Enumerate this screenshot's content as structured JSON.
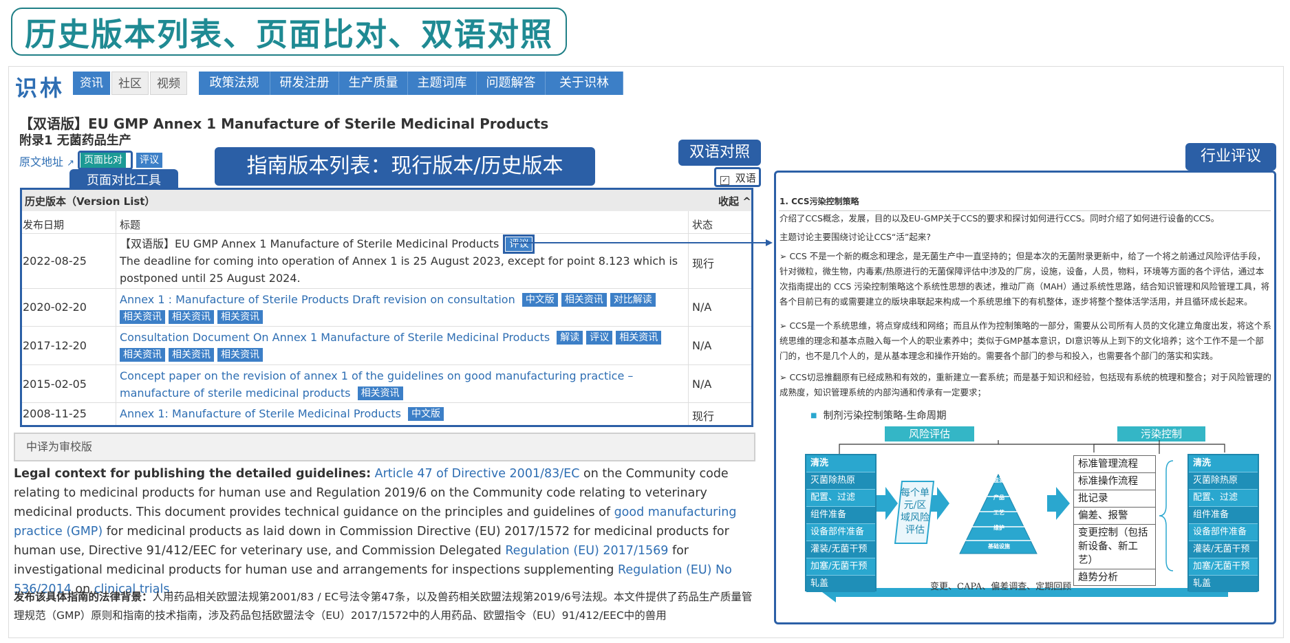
{
  "banner": {
    "title": "历史版本列表、页面比对、双语对照"
  },
  "header": {
    "logo": "识林",
    "pills": [
      "资讯",
      "社区",
      "视频"
    ],
    "nav": [
      "政策法规",
      "研发注册",
      "生产质量",
      "主题词库",
      "问题解答",
      "关于识林"
    ]
  },
  "document": {
    "title": "【双语版】EU GMP Annex 1 Manufacture of Sterile Medicinal Products",
    "subtitle": "附录1 无菌药品生产",
    "orig_link": "原文地址",
    "compare_tag": "页面比对",
    "review_tag": "评议",
    "bilingual_label": "双语"
  },
  "callouts": {
    "bilingual": "双语对照",
    "compare_tool": "页面对比工具",
    "version_list": "指南版本列表：现行版本/历史版本",
    "industry_review": "行业评议"
  },
  "version_table": {
    "title": "历史版本（Version List）",
    "collapse": "收起 ^",
    "columns": [
      "发布日期",
      "标题",
      "状态"
    ],
    "rows": [
      {
        "date": "2022-08-25",
        "title": "【双语版】EU GMP Annex 1 Manufacture of Sterile Medicinal Products",
        "tags": [
          "评议"
        ],
        "note": "The deadline for coming into operation of Annex 1 is 25 August 2023, except for point 8.123 which is postponed until 25 August 2024.",
        "status": "现行"
      },
      {
        "date": "2020-02-20",
        "title": "Annex 1 : Manufacture of Sterile Products Draft revision on consultation",
        "tags": [
          "中文版",
          "相关资讯",
          "对比解读"
        ],
        "tags2": [
          "相关资讯",
          "相关资讯",
          "相关资讯"
        ],
        "status": "N/A"
      },
      {
        "date": "2017-12-20",
        "title": "Consultation Document On Annex 1 Manufacture of Sterile Medicinal Products",
        "tags": [
          "解读",
          "评议",
          "相关资讯"
        ],
        "tags2": [
          "相关资讯",
          "相关资讯",
          "相关资讯"
        ],
        "status": "N/A"
      },
      {
        "date": "2015-02-05",
        "title": "Concept paper on the revision of annex 1 of the guidelines on good manufacturing practice – manufacture of sterile medicinal products",
        "tags": [
          "相关资讯"
        ],
        "status": "N/A"
      },
      {
        "date": "2008-11-25",
        "title": "Annex 1: Manufacture of Sterile Medicinal Products",
        "tags": [
          "中文版"
        ],
        "status": "现行"
      }
    ]
  },
  "note_box": "中译为审校版",
  "legal": {
    "label": "Legal context for publishing the detailed guidelines:",
    "link1": "Article 47 of Directive 2001/83/EC",
    "t1": " on the Community code relating to medicinal products for human use and Regulation 2019/6 on the Community code relating to veterinary medicinal products. This document provides technical guidance on the principles and guidelines of ",
    "link2": "good manufacturing practice (GMP)",
    "t2": " for medicinal products as laid down in Commission Directive (EU) 2017/1572 for medicinal products for human use, Directive 91/412/EEC for veterinary use, and Commission Delegated ",
    "link3": "Regulation (EU) 2017/1569",
    "t3": " for investigational medicinal products for human use and arrangements for inspections supplementing ",
    "link4": "Regulation (EU) No 536/2014",
    "t4": " on ",
    "link5": "clinical trials",
    "t5": "."
  },
  "legal_cn": {
    "label": "发布该具体指南的法律背景：",
    "text": "人用药品相关欧盟法规第2001/83 / EC号法令第47条，以及兽药相关欧盟法规第2019/6号法规。本文件提供了药品生产质量管理规范（GMP）原则和指南的技术指南，涉及药品包括欧盟法令（EU）2017/1572中的人用药品、欧盟指令（EU）91/412/EEC中的兽用"
  },
  "review": {
    "heading": "1. CCS污染控制策略",
    "intro": "介绍了CCS概念，发展，目的以及EU-GMP关于CCS的要求和探讨如何进行CCS。同时介绍了如何进行设备的CCS。",
    "q": "主题讨论主要围绕讨论让CCS“活”起来?",
    "p1": "➢ CCS 不是一个新的概念和理念，是无菌生产中一直坚持的；但是本次的无菌附录更新中，给了一个将之前通过风险评估手段，针对微粒，微生物，内毒素/热原进行的无菌保障评估中涉及的厂房，设施，设备，人员，物料，环境等方面的各个评估，通过本次指南提出的 CCS 污染控制策略这个系统性思想的表述，推动厂商（MAH）通过系统性思路，结合知识管理和风险管理工具，将各个目前已有的或需要建立的版块串联起来构成一个系统思维下的有机整体，逐步将整个整体活学活用，并且循环成长起来。",
    "p2": "➢ CCS是一个系统思维，将点穿成线和网络；而且从作为控制策略的一部分，需要从公司所有人员的文化建立角度出发，将这个系统思维的理念和基本点融入每一个人的职业素养中；类似于GMP基本意识，DI意识等从上到下的文化培养；这个工作不是一个部门的，也不是几个人的，是从基本理念和操作开始的。需要各个部门的参与和投入，也需要各个部门的落实和实践。",
    "p3": "➢ CCS切忌推翻原有已经成熟和有效的，重新建立一套系统；而是基于知识和经验，包括现有系统的梳理和整合；对于风险管理的成熟度，知识管理系统的内部沟通和传承有一定要求；"
  },
  "diagram": {
    "title": "制剂污染控制策略-生命周期",
    "risk_label": "风险评估",
    "contam_label": "污染控制",
    "left_items": [
      "清洗",
      "灭菌除热原",
      "配置、过滤",
      "组件准备",
      "设备部件准备",
      "灌装/无菌干预",
      "加塞/无菌干预",
      "轧盖"
    ],
    "unit_text": "每个单元/区域风险评估",
    "pyramid": [
      "监测",
      "产品",
      "工艺",
      "维护",
      "基础设施"
    ],
    "mid_items": [
      "标准管理流程",
      "标准操作流程",
      "批记录",
      "偏差、报警",
      "变更控制（包括新设备、新工艺）",
      "趋势分析"
    ],
    "right_items": [
      "清洗",
      "灭菌除热原",
      "配置、过滤",
      "组件准备",
      "设备部件准备",
      "灌装/无菌干预",
      "加塞/无菌干预",
      "轧盖"
    ],
    "bottom": "变更、CAPA、偏差调查、定期回顾"
  }
}
